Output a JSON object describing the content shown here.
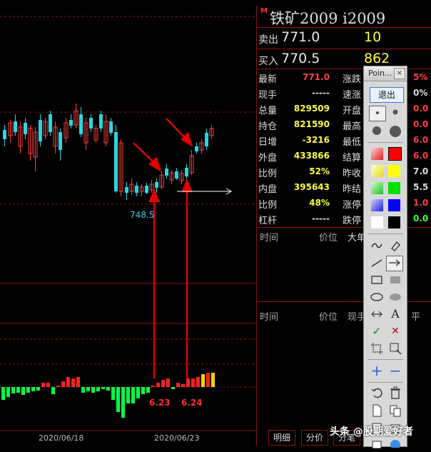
{
  "chart": {
    "price_label": "748.5",
    "vol_label_1": "6.23",
    "vol_label_2": "6.24",
    "x_labels": [
      "2020/06/18",
      "2020/06/23"
    ]
  },
  "quote": {
    "title": "铁矿2009  i2009",
    "title_badge": "M",
    "sell_label": "卖出",
    "sell_price": "771.0",
    "sell_vol": "10",
    "buy_label": "买入",
    "buy_price": "770.5",
    "buy_vol": "862",
    "rows": [
      {
        "label": "最新",
        "value": "771.0",
        "color": "#ff4040",
        "label2": "涨跌",
        "value2": "5%",
        "color2": "#ff4040"
      },
      {
        "label": "现手",
        "value": "-----",
        "color": "#dddddd",
        "label2": "速涨",
        "value2": "0%",
        "color2": "#dddddd"
      },
      {
        "label": "总量",
        "value": "829509",
        "color": "#ffff40",
        "label2": "开盘",
        "value2": "0.0",
        "color2": "#ff4040"
      },
      {
        "label": "持仓",
        "value": "821590",
        "color": "#ffff40",
        "label2": "最高",
        "value2": "0.0",
        "color2": "#ff4040"
      },
      {
        "label": "日增",
        "value": "-3216",
        "color": "#ffff40",
        "label2": "最低",
        "value2": "6.0",
        "color2": "#ff4040"
      },
      {
        "label": "外盘",
        "value": "433866",
        "color": "#ffff40",
        "label2": "结算",
        "value2": "6.0",
        "color2": "#ff4040"
      },
      {
        "label": "比例",
        "value": "52%",
        "color": "#ffff40",
        "label2": "昨收",
        "value2": "7.0",
        "color2": "#dddddd"
      },
      {
        "label": "内盘",
        "value": "395643",
        "color": "#ffff40",
        "label2": "昨结",
        "value2": "5.5",
        "color2": "#dddddd"
      },
      {
        "label": "比例",
        "value": "48%",
        "color": "#ffff40",
        "label2": "涨停",
        "value2": "1.0",
        "color2": "#ff4040"
      },
      {
        "label": "杠杆",
        "value": "-----",
        "color": "#dddddd",
        "label2": "跌停",
        "value2": "0.0",
        "color2": "#40ff40"
      }
    ],
    "ticks_header": {
      "time": "时间",
      "price": "价位",
      "col3": "大单"
    },
    "trades_header": {
      "time": "时间",
      "price": "价位",
      "col3": "现手",
      "col4": "平"
    },
    "tabs": [
      "明细",
      "分价",
      "分笔"
    ]
  },
  "toolbox": {
    "title": "Poin...",
    "close": "×",
    "exit_label": "退出"
  },
  "watermark": "头条 @股期爱好者"
}
